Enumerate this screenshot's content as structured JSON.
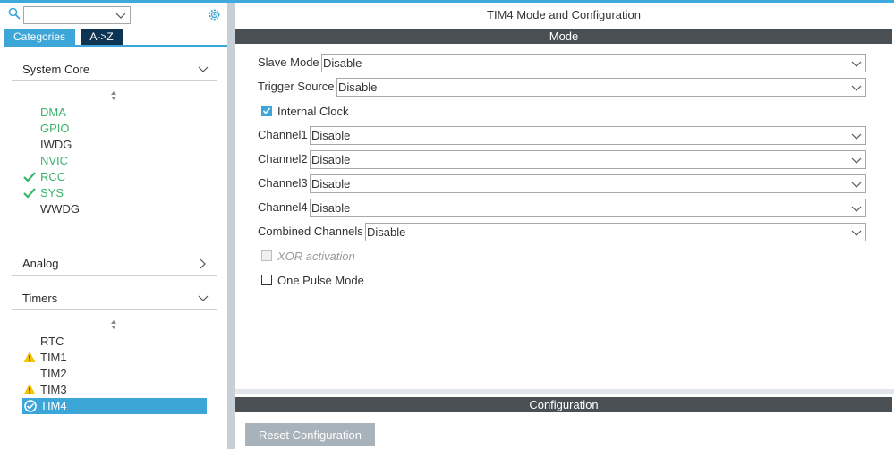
{
  "sidebar": {
    "search": {
      "value": ""
    },
    "tabs": [
      {
        "label": "Categories",
        "active": true
      },
      {
        "label": "A->Z",
        "active": false
      }
    ],
    "sections": {
      "system_core": {
        "title": "System Core",
        "expanded": true,
        "items": [
          {
            "label": "DMA",
            "status": "configured"
          },
          {
            "label": "GPIO",
            "status": "configured"
          },
          {
            "label": "IWDG",
            "status": "none"
          },
          {
            "label": "NVIC",
            "status": "configured"
          },
          {
            "label": "RCC",
            "status": "check"
          },
          {
            "label": "SYS",
            "status": "check"
          },
          {
            "label": "WWDG",
            "status": "none"
          }
        ]
      },
      "analog": {
        "title": "Analog",
        "expanded": false
      },
      "timers": {
        "title": "Timers",
        "expanded": true,
        "items": [
          {
            "label": "RTC",
            "status": "none"
          },
          {
            "label": "TIM1",
            "status": "warning"
          },
          {
            "label": "TIM2",
            "status": "none"
          },
          {
            "label": "TIM3",
            "status": "warning"
          },
          {
            "label": "TIM4",
            "status": "selected-ok"
          }
        ]
      }
    }
  },
  "main": {
    "title": "TIM4 Mode and Configuration",
    "mode_header": "Mode",
    "fields": {
      "slave_mode": {
        "label": "Slave Mode",
        "value": "Disable"
      },
      "trigger_source": {
        "label": "Trigger Source",
        "value": "Disable"
      },
      "internal_clock": {
        "label": "Internal Clock",
        "checked": true
      },
      "channel1": {
        "label": "Channel1",
        "value": "Disable"
      },
      "channel2": {
        "label": "Channel2",
        "value": "Disable"
      },
      "channel3": {
        "label": "Channel3",
        "value": "Disable"
      },
      "channel4": {
        "label": "Channel4",
        "value": "Disable"
      },
      "combined_channels": {
        "label": "Combined Channels",
        "value": "Disable"
      },
      "xor_activation": {
        "label": "XOR activation",
        "checked": false,
        "disabled": true
      },
      "one_pulse_mode": {
        "label": "One Pulse Mode",
        "checked": false
      }
    },
    "configuration_header": "Configuration",
    "reset_button": "Reset Configuration"
  },
  "colors": {
    "accent": "#3ca6d9",
    "configured_green": "#3bb36d",
    "warning_yellow": "#f5c400",
    "header_bar": "#4a4f54"
  }
}
